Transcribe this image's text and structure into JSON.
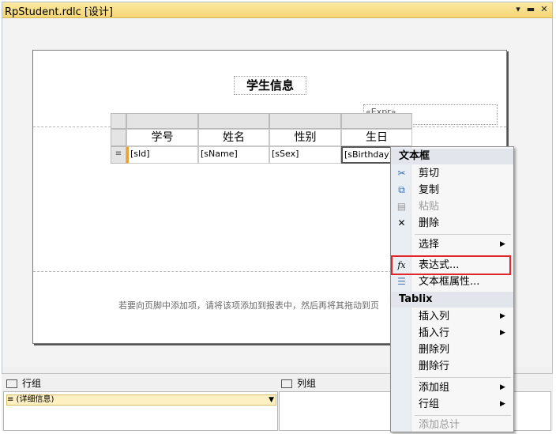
{
  "window": {
    "title": "RpStudent.rdlc [设计]",
    "controls": {
      "dropdown": "▾",
      "pin": "▬",
      "close": "✕"
    }
  },
  "report": {
    "title": "学生信息",
    "expr_placeholder": "«Expr»",
    "footer_hint": "若要向页脚中添加项，请将该项添加到报表中，然后再将其拖动到页",
    "tablix": {
      "headers": [
        "学号",
        "姓名",
        "性别",
        "生日"
      ],
      "row": [
        "[sId]",
        "[sName]",
        "[sSex]",
        "[sBirthday]"
      ],
      "row_handle_icon": "≡"
    }
  },
  "context_menu": {
    "section_textbox": "文本框",
    "cut": "剪切",
    "copy": "复制",
    "paste": "粘贴",
    "delete": "删除",
    "select": "选择",
    "expression": "表达式...",
    "textbox_props": "文本框属性...",
    "section_tablix": "Tablix",
    "insert_col": "插入列",
    "insert_row": "插入行",
    "delete_col": "删除列",
    "delete_row": "删除行",
    "add_group": "添加组",
    "row_group": "行组",
    "add_total": "添加总计",
    "icons": {
      "cut": "✂",
      "copy": "⧉",
      "paste": "▤",
      "delete": "✕",
      "expression": "fx",
      "textbox_props": "☰"
    }
  },
  "groups": {
    "row_label": "行组",
    "col_label": "列组",
    "detail": "≡ (详细信息)"
  }
}
